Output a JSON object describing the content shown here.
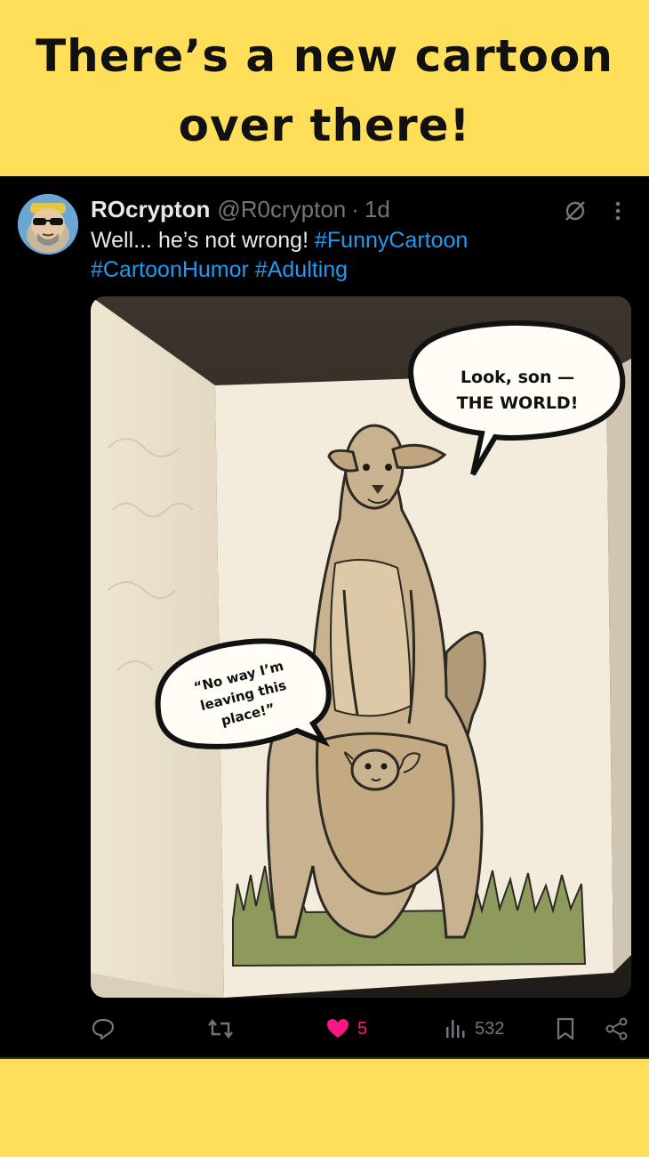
{
  "banner": {
    "line1": "There’s a new cartoon",
    "line2": "over there!"
  },
  "tweet": {
    "display_name": "ROcrypton",
    "handle": "@R0crypton",
    "separator": "·",
    "time": "1d",
    "text_prefix": "Well... he’s not wrong! ",
    "hashtags": [
      "#FunnyCartoon",
      "#CartoonHumor",
      "#Adulting"
    ],
    "image": {
      "bubble_top_line1": "Look, son —",
      "bubble_top_line2": "THE WORLD!",
      "bubble_left_line1": "“No way I’m",
      "bubble_left_line2": "leaving this",
      "bubble_left_line3": "place!”"
    },
    "actions": {
      "replies": "",
      "reposts": "",
      "likes": "5",
      "views": "532"
    }
  },
  "colors": {
    "banner_bg": "#FFDE59",
    "tweet_bg": "#000000",
    "link": "#1d9bf0",
    "like": "#f91880",
    "muted": "#71767b"
  },
  "icons": [
    "grok-icon",
    "more-icon",
    "reply-icon",
    "repost-icon",
    "heart-icon",
    "views-icon",
    "bookmark-icon",
    "share-icon"
  ]
}
